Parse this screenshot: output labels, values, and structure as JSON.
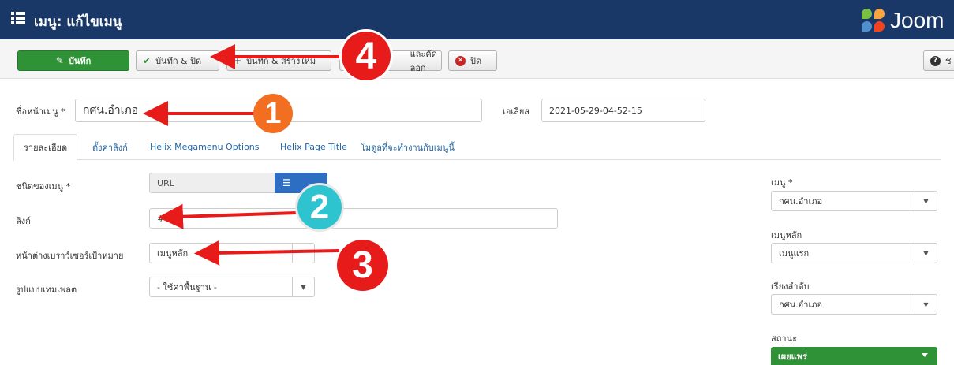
{
  "header": {
    "title": "เมนู: แก้ไขเมนู",
    "logo_text": "Joom"
  },
  "toolbar": {
    "save_label": "บันทึก",
    "save_close_label": "บันทึก & ปิด",
    "save_new_label": "บันทึก & สร้างใหม่",
    "save_copy_label": "และคัดลอก",
    "close_label": "ปิด",
    "help_label": "ช"
  },
  "form": {
    "title_label": "ชื่อหน้าเมนู *",
    "title_value": "กศน.อำเภอ",
    "alias_label": "เอเลียส",
    "alias_value": "2021-05-29-04-52-15"
  },
  "tabs": [
    {
      "label": "รายละเอียด",
      "active": true
    },
    {
      "label": "ตั้งค่าลิงก์"
    },
    {
      "label": "Helix Megamenu Options"
    },
    {
      "label": "Helix Page Title"
    },
    {
      "label": "โมดูลที่จะทำงานกับเมนูนี้"
    }
  ],
  "details": {
    "menu_type_label": "ชนิดของเมนู *",
    "menu_type_value": "URL",
    "link_label": "ลิงก์",
    "link_value": "#",
    "target_label": "หน้าต่างเบราว์เซอร์เป้าหมาย",
    "target_value": "เมนูหลัก",
    "template_label": "รูปแบบเทมเพลต",
    "template_value": "- ใช้ค่าพื้นฐาน -"
  },
  "sidebar": {
    "menu_label": "เมนู *",
    "menu_value": "กศน.อำเภอ",
    "parent_label": "เมนูหลัก",
    "parent_value": "เมนูแรก",
    "order_label": "เรียงลำดับ",
    "order_value": "กศน.อำเภอ",
    "status_label": "สถานะ",
    "status_value": "เผยแพร่"
  },
  "annotations": {
    "n1": "1",
    "n2": "2",
    "n3": "3",
    "n4": "4"
  },
  "colors": {
    "header_bg": "#1a3867",
    "save_green": "#2f9236",
    "arrow_red": "#e81b1b",
    "badge_orange": "#f26f21",
    "badge_teal": "#2ec4cf",
    "link_blue": "#1f65a6"
  }
}
